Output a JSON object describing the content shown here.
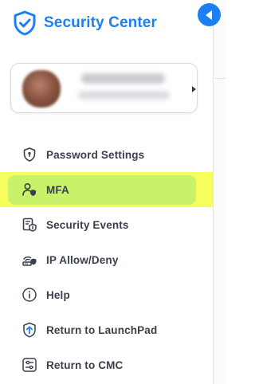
{
  "header": {
    "title": "Security Center",
    "logo_icon": "shield-check-icon",
    "accent_color": "#1e80ef"
  },
  "collapse_button": {
    "icon": "chevron-left-icon",
    "color": "#1e7ff0"
  },
  "profile": {
    "name": "",
    "subtitle": "",
    "expand_icon": "caret-right-icon"
  },
  "nav": {
    "items": [
      {
        "label": "Password Settings",
        "icon": "shield-keyhole-icon",
        "active": false
      },
      {
        "label": "MFA",
        "icon": "user-shield-icon",
        "active": true
      },
      {
        "label": "Security Events",
        "icon": "log-shield-icon",
        "active": false
      },
      {
        "label": "IP Allow/Deny",
        "icon": "network-shield-icon",
        "active": false
      },
      {
        "label": "Help",
        "icon": "info-circle-icon",
        "active": false
      },
      {
        "label": "Return to LaunchPad",
        "icon": "upload-arrow-icon",
        "active": false
      },
      {
        "label": "Return to CMC",
        "icon": "sliders-box-icon",
        "active": false
      }
    ],
    "active_highlight_color": "#c8f26a",
    "active_outer_color": "#f6ff5e"
  }
}
